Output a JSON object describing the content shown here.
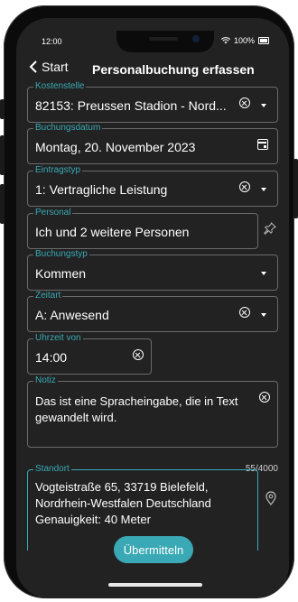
{
  "status_bar": {
    "time": "12:00",
    "battery": "100%"
  },
  "header": {
    "back_label": "Start",
    "title": "Personalbuchung erfassen"
  },
  "form": {
    "kostenstelle": {
      "label": "Kostenstelle",
      "value": "82153: Preussen Stadion - Nord..."
    },
    "buchungsdatum": {
      "label": "Buchungsdatum",
      "value": "Montag, 20. November 2023"
    },
    "eintragstyp": {
      "label": "Eintragstyp",
      "value": "1: Vertragliche Leistung"
    },
    "personal": {
      "label": "Personal",
      "value": "Ich und 2 weitere Personen"
    },
    "buchungstyp": {
      "label": "Buchungstyp",
      "value": "Kommen"
    },
    "zeitart": {
      "label": "Zeitart",
      "value": "A: Anwesend"
    },
    "uhrzeit_von": {
      "label": "Uhrzeit von",
      "value": "14:00"
    },
    "notiz": {
      "label": "Notiz",
      "value": "Das ist eine Spracheingabe, die in Text gewandelt wird.",
      "counter": "55/4000"
    },
    "standort": {
      "label": "Standort",
      "value": "Vogteistraße 65, 33719 Bielefeld, Nordrhein-Westfalen Deutschland Genauigkeit: 40 Meter"
    }
  },
  "submit_label": "Übermitteln",
  "colors": {
    "accent": "#3aa9b5",
    "background": "#222222",
    "border": "#6b6b6b"
  }
}
